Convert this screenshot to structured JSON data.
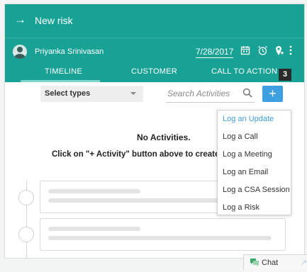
{
  "header": {
    "back_icon": "arrow-right-icon",
    "title": "New risk",
    "owner_name": "Priyanka Srinivasan",
    "date": "7/28/2017",
    "icons": [
      "calendar-icon",
      "alarm-clock-icon",
      "user-pin-icon",
      "more-vertical-icon"
    ],
    "tabs": [
      {
        "label": "TIMELINE",
        "active": true
      },
      {
        "label": "CUSTOMER",
        "active": false
      },
      {
        "label": "CALL TO ACTION",
        "active": false
      }
    ],
    "badge": "3"
  },
  "toolbar": {
    "select_label": "Select types",
    "search_placeholder": "Search Activities",
    "add_label": "+"
  },
  "empty": {
    "title": "No Activities.",
    "message": "Click on \"+ Activity\" button above to create y"
  },
  "add_menu": {
    "items": [
      {
        "label": "Log an Update",
        "highlighted": true
      },
      {
        "label": "Log a Call",
        "highlighted": false
      },
      {
        "label": "Log a Meeting",
        "highlighted": false
      },
      {
        "label": "Log an Email",
        "highlighted": false
      },
      {
        "label": "Log a CSA Session",
        "highlighted": false
      },
      {
        "label": "Log a Risk",
        "highlighted": false
      }
    ]
  },
  "chat": {
    "label": "Chat",
    "icon": "chat-bubble-icon"
  },
  "colors": {
    "header": "#18a295",
    "accent": "#3d9ee0",
    "tab_underline": "#7fd3ca"
  }
}
